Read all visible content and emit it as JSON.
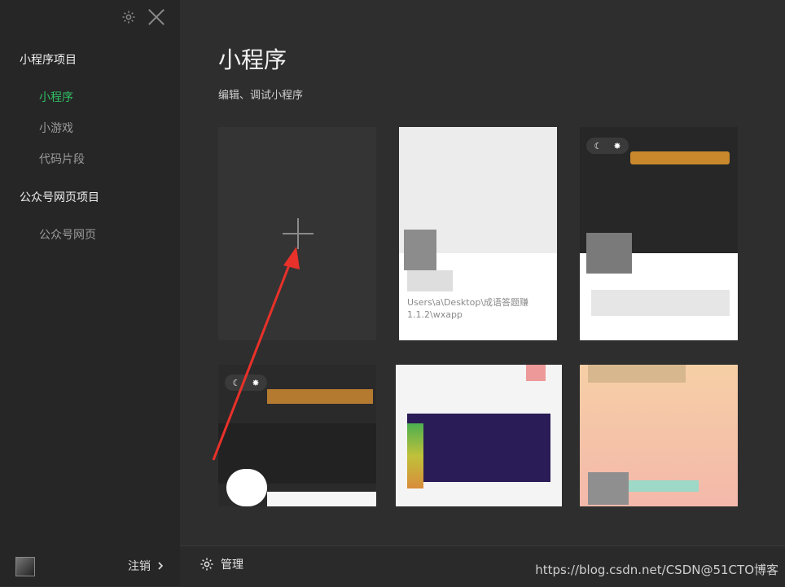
{
  "sidebar": {
    "section_mini": "小程序项目",
    "items_mini": [
      "小程序",
      "小游戏",
      "代码片段"
    ],
    "section_public": "公众号网页项目",
    "items_public": [
      "公众号网页"
    ],
    "logout": "注销"
  },
  "main": {
    "title": "小程序",
    "subtitle": "编辑、调试小程序",
    "project_path": "Users\\a\\Desktop\\成语答题赚 1.1.2\\wxapp"
  },
  "bottom": {
    "manage": "管理",
    "watermark": "https://blog.csdn.net/CSDN@51CTO博客"
  },
  "colors": {
    "accent": "#2fbf64",
    "arrow": "#e8312a",
    "tip": "#c8882b"
  },
  "icons": [
    "gear-icon",
    "close-icon",
    "plus-icon",
    "arrow-annotation",
    "chevron-right-icon",
    "manage-gear-icon"
  ]
}
